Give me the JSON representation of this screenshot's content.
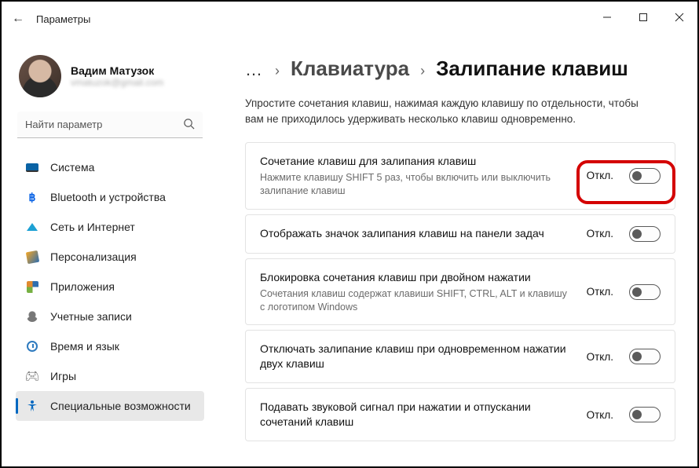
{
  "titlebar": {
    "title": "Параметры"
  },
  "profile": {
    "name": "Вадим Матузок",
    "email": "vmatuzok@gmail.com"
  },
  "search": {
    "placeholder": "Найти параметр"
  },
  "sidebar": {
    "items": [
      {
        "label": "Система"
      },
      {
        "label": "Bluetooth и устройства"
      },
      {
        "label": "Сеть и Интернет"
      },
      {
        "label": "Персонализация"
      },
      {
        "label": "Приложения"
      },
      {
        "label": "Учетные записи"
      },
      {
        "label": "Время и язык"
      },
      {
        "label": "Игры"
      },
      {
        "label": "Специальные возможности"
      }
    ]
  },
  "breadcrumb": {
    "parent": "Клавиатура",
    "current": "Залипание клавиш"
  },
  "description": "Упростите сочетания клавиш, нажимая каждую клавишу по отдельности, чтобы вам не приходилось удерживать несколько клавиш одновременно.",
  "state_off": "Откл.",
  "settings": [
    {
      "title": "Сочетание клавиш для залипания клавиш",
      "sub": "Нажмите клавишу SHIFT 5 раз, чтобы включить или выключить залипание клавиш"
    },
    {
      "title": "Отображать значок залипания клавиш на панели задач",
      "sub": ""
    },
    {
      "title": "Блокировка сочетания клавиш при двойном нажатии",
      "sub": "Сочетания клавиш содержат клавиши SHIFT, CTRL, ALT и клавишу с логотипом Windows"
    },
    {
      "title": "Отключать залипание клавиш при одновременном нажатии двух клавиш",
      "sub": ""
    },
    {
      "title": "Подавать звуковой сигнал при нажатии и отпускании сочетаний клавиш",
      "sub": ""
    }
  ]
}
